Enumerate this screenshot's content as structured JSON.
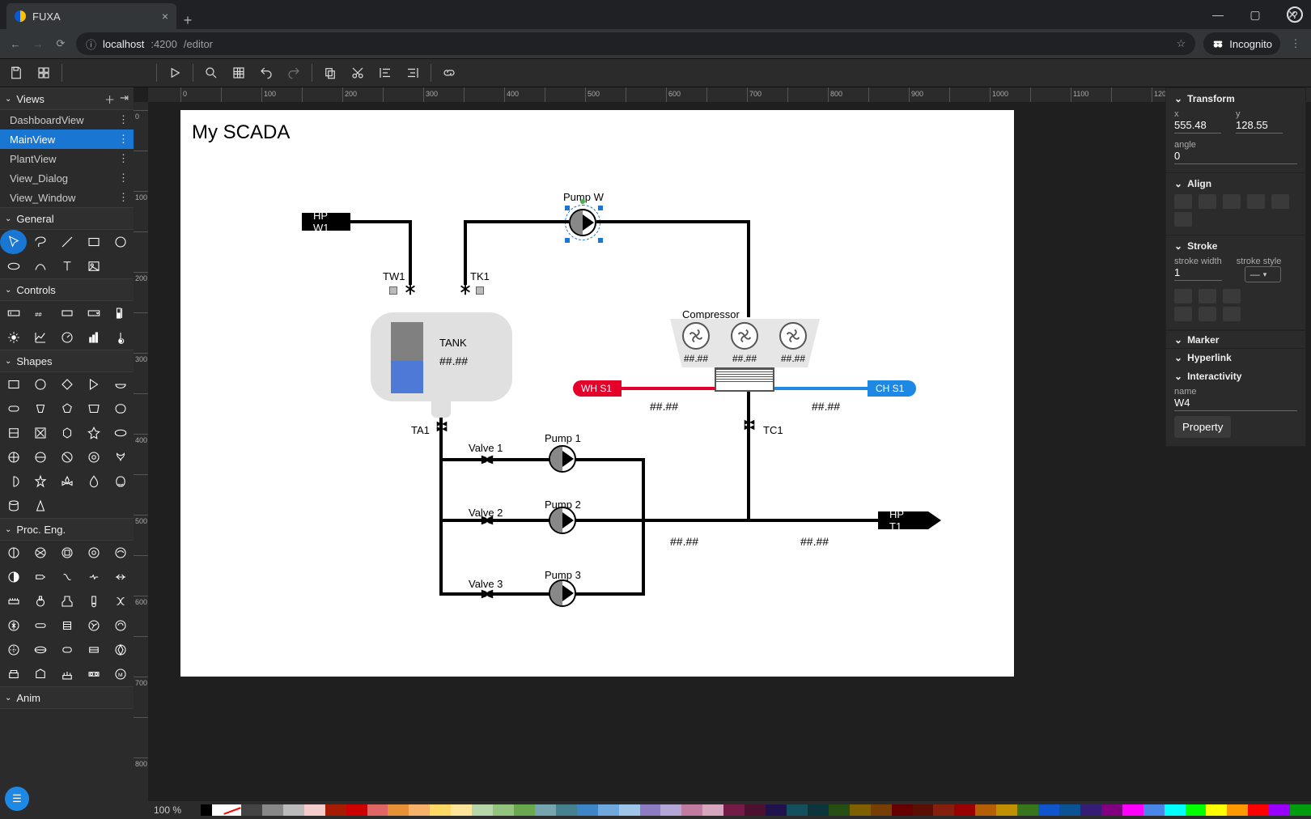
{
  "browser": {
    "tab_title": "FUXA",
    "url_host": "localhost",
    "url_port": ":4200",
    "url_path": "/editor",
    "incognito_label": "Incognito"
  },
  "toolbar": {},
  "sidebar": {
    "views_label": "Views",
    "views": [
      {
        "label": "DashboardView",
        "selected": false
      },
      {
        "label": "MainView",
        "selected": true
      },
      {
        "label": "PlantView",
        "selected": false
      },
      {
        "label": "View_Dialog",
        "selected": false
      },
      {
        "label": "View_Window",
        "selected": false
      }
    ],
    "sections": {
      "general": "General",
      "controls": "Controls",
      "shapes": "Shapes",
      "proceng": "Proc. Eng.",
      "anim": "Anim"
    }
  },
  "canvas": {
    "title": "My SCADA",
    "tags": {
      "hp_w1": "HP W1",
      "hp_t1": "HP T1",
      "wh_s1": "WH S1",
      "ch_s1": "CH S1"
    },
    "labels": {
      "pump_w": "Pump W",
      "tw1": "TW1",
      "tk1": "TK1",
      "tank": "TANK",
      "tank_val": "##.##",
      "compressor": "Compressor",
      "comp_v1": "##.##",
      "comp_v2": "##.##",
      "comp_v3": "##.##",
      "wh_val": "##.##",
      "ch_val": "##.##",
      "ta1": "TA1",
      "tc1": "TC1",
      "pump1": "Pump 1",
      "pump2": "Pump 2",
      "pump3": "Pump 3",
      "valve1": "Valve 1",
      "valve2": "Valve 2",
      "valve3": "Valve 3",
      "row2_v1": "##.##",
      "row2_v2": "##.##"
    }
  },
  "props": {
    "transform_label": "Transform",
    "x_label": "x",
    "x_value": "555.48",
    "y_label": "y",
    "y_value": "128.55",
    "angle_label": "angle",
    "angle_value": "0",
    "align_label": "Align",
    "stroke_label": "Stroke",
    "stroke_width_label": "stroke width",
    "stroke_width_value": "1",
    "stroke_style_label": "stroke style",
    "marker_label": "Marker",
    "hyperlink_label": "Hyperlink",
    "interactivity_label": "Interactivity",
    "name_label": "name",
    "name_value": "W4",
    "property_btn": "Property"
  },
  "status": {
    "zoom": "100 %",
    "swatches": [
      "#000000",
      "#ffffff",
      "NO",
      "#444444",
      "#888888",
      "#bbbbbb",
      "#f4cccc",
      "#a61c00",
      "#cc0000",
      "#e06666",
      "#e69138",
      "#f6b26b",
      "#ffd966",
      "#ffe599",
      "#b6d7a8",
      "#93c47d",
      "#6aa84f",
      "#76a5af",
      "#45818e",
      "#3d85c6",
      "#6fa8dc",
      "#9fc5e8",
      "#8e7cc3",
      "#b4a7d6",
      "#c27ba0",
      "#d5a6bd",
      "#741b47",
      "#4c1130",
      "#20124d",
      "#134f5c",
      "#0c343d",
      "#274e13",
      "#7f6000",
      "#783f04",
      "#660000",
      "#5b0f00",
      "#85200c",
      "#990000",
      "#b45f06",
      "#bf9000",
      "#38761d",
      "#1155cc",
      "#0b5394",
      "#351c75",
      "#800080",
      "#ff00ff",
      "#4a86e8",
      "#00ffff",
      "#00ff00",
      "#ffff00",
      "#ff9900",
      "#ff0000",
      "#9900ff",
      "#009e0f"
    ]
  }
}
